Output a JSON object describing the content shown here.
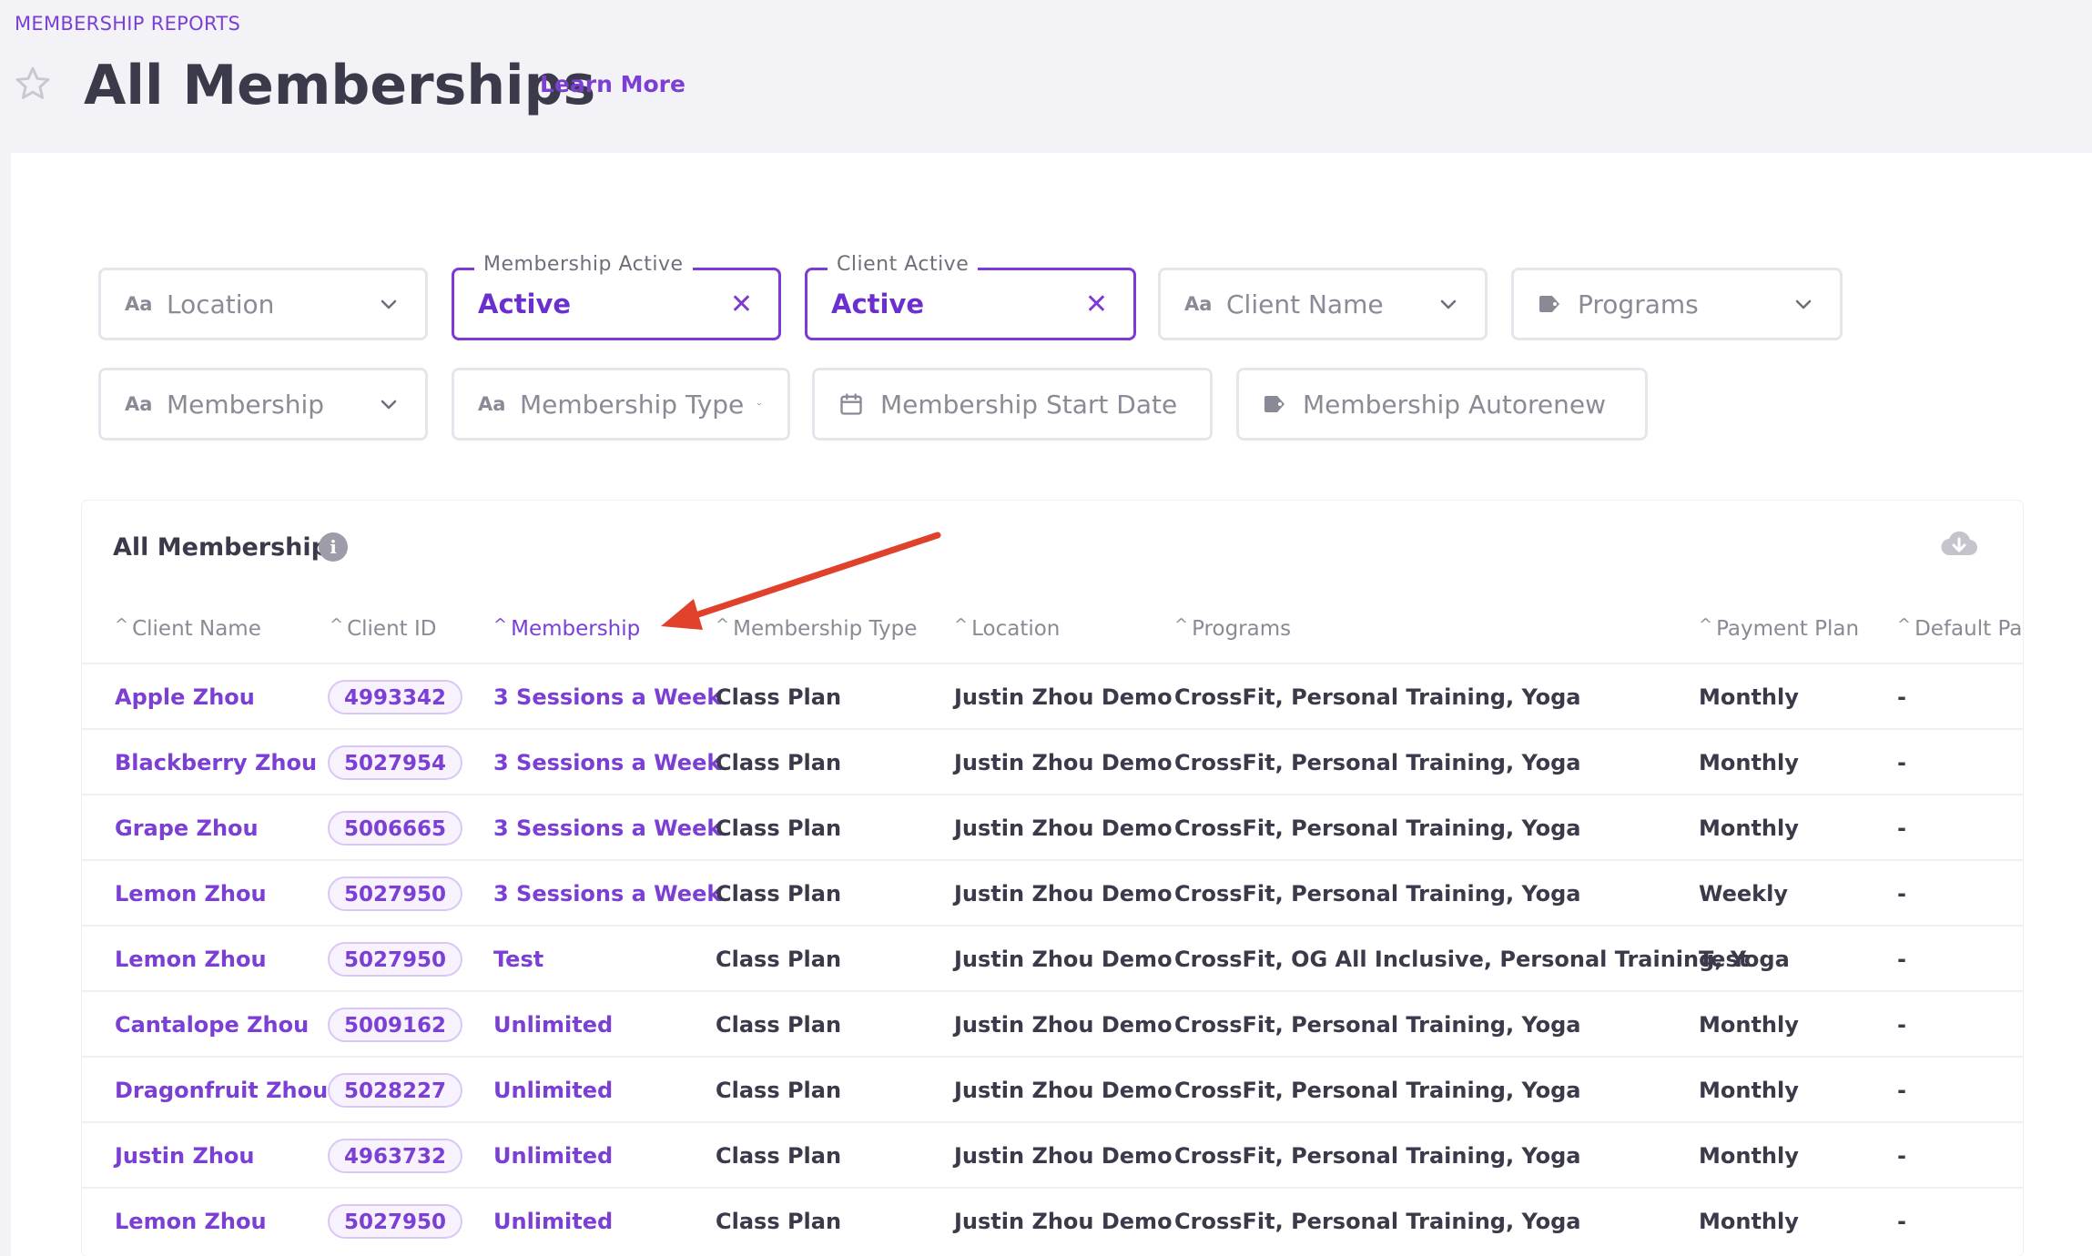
{
  "breadcrumb": "MEMBERSHIP REPORTS",
  "title": "All Memberships",
  "learn_more": "Learn More",
  "filters": {
    "location": "Location",
    "membership_active_legend": "Membership Active",
    "membership_active_value": "Active",
    "client_active_legend": "Client Active",
    "client_active_value": "Active",
    "client_name": "Client Name",
    "programs": "Programs",
    "membership": "Membership",
    "membership_type": "Membership Type",
    "membership_start_date": "Membership Start Date",
    "membership_autorenew": "Membership Autorenew",
    "text_type_icon": "Aa"
  },
  "card": {
    "title": "All Memberships",
    "info_icon": "i"
  },
  "columns": {
    "client_name": "Client Name",
    "client_id": "Client ID",
    "membership": "Membership",
    "membership_type": "Membership Type",
    "location": "Location",
    "programs": "Programs",
    "payment_plan": "Payment Plan",
    "default_pa": "Default Pa",
    "caret": "^"
  },
  "rows": [
    {
      "client_name": "Apple Zhou",
      "client_id": "4993342",
      "membership": "3 Sessions a Week",
      "membership_type": "Class Plan",
      "location": "Justin Zhou Demo",
      "programs": "CrossFit, Personal Training, Yoga",
      "payment_plan": "Monthly",
      "default": "-"
    },
    {
      "client_name": "Blackberry Zhou",
      "client_id": "5027954",
      "membership": "3 Sessions a Week",
      "membership_type": "Class Plan",
      "location": "Justin Zhou Demo",
      "programs": "CrossFit, Personal Training, Yoga",
      "payment_plan": "Monthly",
      "default": "-"
    },
    {
      "client_name": "Grape Zhou",
      "client_id": "5006665",
      "membership": "3 Sessions a Week",
      "membership_type": "Class Plan",
      "location": "Justin Zhou Demo",
      "programs": "CrossFit, Personal Training, Yoga",
      "payment_plan": "Monthly",
      "default": "-"
    },
    {
      "client_name": "Lemon Zhou",
      "client_id": "5027950",
      "membership": "3 Sessions a Week",
      "membership_type": "Class Plan",
      "location": "Justin Zhou Demo",
      "programs": "CrossFit, Personal Training, Yoga",
      "payment_plan": "Weekly",
      "default": "-"
    },
    {
      "client_name": "Lemon Zhou",
      "client_id": "5027950",
      "membership": "Test",
      "membership_type": "Class Plan",
      "location": "Justin Zhou Demo",
      "programs": "CrossFit, OG All Inclusive, Personal Training, Yoga",
      "payment_plan": "Test",
      "default": "-"
    },
    {
      "client_name": "Cantalope Zhou",
      "client_id": "5009162",
      "membership": "Unlimited",
      "membership_type": "Class Plan",
      "location": "Justin Zhou Demo",
      "programs": "CrossFit, Personal Training, Yoga",
      "payment_plan": "Monthly",
      "default": "-"
    },
    {
      "client_name": "Dragonfruit Zhou",
      "client_id": "5028227",
      "membership": "Unlimited",
      "membership_type": "Class Plan",
      "location": "Justin Zhou Demo",
      "programs": "CrossFit, Personal Training, Yoga",
      "payment_plan": "Monthly",
      "default": "-"
    },
    {
      "client_name": "Justin Zhou",
      "client_id": "4963732",
      "membership": "Unlimited",
      "membership_type": "Class Plan",
      "location": "Justin Zhou Demo",
      "programs": "CrossFit, Personal Training, Yoga",
      "payment_plan": "Monthly",
      "default": "-"
    },
    {
      "client_name": "Lemon Zhou",
      "client_id": "5027950",
      "membership": "Unlimited",
      "membership_type": "Class Plan",
      "location": "Justin Zhou Demo",
      "programs": "CrossFit, Personal Training, Yoga",
      "payment_plan": "Monthly",
      "default": "-"
    }
  ],
  "icons": {
    "star": "star-icon",
    "chevron": "chevron-down-icon",
    "clear": "close-icon",
    "calendar": "calendar-icon",
    "tag": "tag-icon",
    "info": "info-icon",
    "download": "cloud-download-icon",
    "arrow": "annotation-arrow"
  },
  "colors": {
    "accent": "#7b3fd4",
    "text": "#3b3a4a",
    "muted": "#8a8a96",
    "arrow": "#e0412b",
    "background": "#f3f3f7"
  }
}
